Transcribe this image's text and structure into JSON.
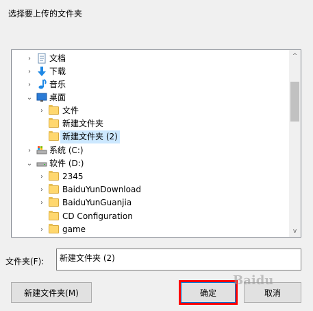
{
  "dialog": {
    "title": "选择要上传的文件夹"
  },
  "tree": {
    "items": [
      {
        "label": "文档",
        "icon": "document-icon",
        "chevron": "›"
      },
      {
        "label": "下载",
        "icon": "download-arrow-icon",
        "chevron": "›"
      },
      {
        "label": "音乐",
        "icon": "music-note-icon",
        "chevron": "›"
      },
      {
        "label": "桌面",
        "icon": "desktop-icon",
        "chevron": "⌄"
      },
      {
        "label": "文件",
        "icon": "folder-icon",
        "chevron": "›"
      },
      {
        "label": "新建文件夹",
        "icon": "folder-icon",
        "chevron": ""
      },
      {
        "label": "新建文件夹 (2)",
        "icon": "folder-icon",
        "chevron": "",
        "selected": true
      },
      {
        "label": "系统 (C:)",
        "icon": "system-drive-icon",
        "chevron": "›"
      },
      {
        "label": "软件 (D:)",
        "icon": "drive-icon",
        "chevron": "⌄"
      },
      {
        "label": "2345",
        "icon": "folder-icon",
        "chevron": "›"
      },
      {
        "label": "BaiduYunDownload",
        "icon": "folder-icon",
        "chevron": "›"
      },
      {
        "label": "BaiduYunGuanjia",
        "icon": "folder-icon",
        "chevron": "›"
      },
      {
        "label": "CD Configuration",
        "icon": "folder-icon",
        "chevron": ""
      },
      {
        "label": "game",
        "icon": "folder-icon",
        "chevron": "›"
      }
    ]
  },
  "scrollbar": {
    "up": "^",
    "down": "v"
  },
  "folder_field": {
    "label": "文件夹(F):",
    "value": "新建文件夹 (2)"
  },
  "buttons": {
    "new_folder": "新建文件夹(M)",
    "ok": "确定",
    "cancel": "取消"
  },
  "watermark": {
    "text": "Baidu"
  },
  "colors": {
    "selection": "#cce8ff",
    "highlight_border": "#ff0000",
    "accent": "#0078d7"
  }
}
